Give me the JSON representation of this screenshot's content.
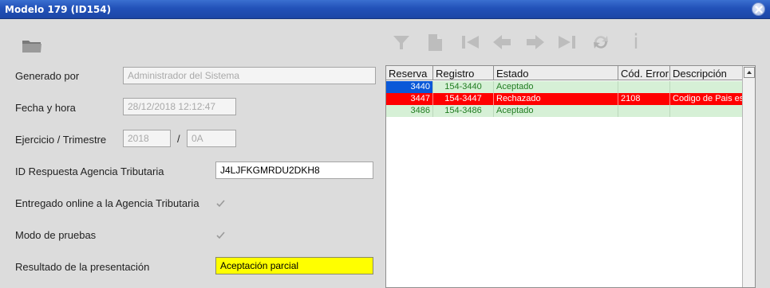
{
  "window": {
    "title": "Modelo 179 (ID154)"
  },
  "toolbar": {
    "icons": [
      "folder-icon",
      "filter-icon",
      "new-document-icon",
      "first-record-icon",
      "previous-record-icon",
      "next-record-icon",
      "last-record-icon",
      "refresh-icon",
      "info-icon"
    ],
    "info_glyph": "i"
  },
  "form": {
    "generado_por": {
      "label": "Generado por",
      "value": "Administrador del Sistema"
    },
    "fecha_hora": {
      "label": "Fecha y hora",
      "value": "28/12/2018  12:12:47"
    },
    "ejercicio": {
      "label": "Ejercicio / Trimestre",
      "year": "2018",
      "separator": "/",
      "quarter": "0A"
    },
    "id_respuesta": {
      "label": "ID Respuesta Agencia Tributaria",
      "value": "J4LJFKGMRDU2DKH8"
    },
    "entregado_online": {
      "label": "Entregado online a la Agencia Tributaria",
      "checked": true
    },
    "modo_pruebas": {
      "label": "Modo de pruebas",
      "checked": true
    },
    "resultado": {
      "label": "Resultado de la presentación",
      "value": "Aceptación parcial",
      "highlight": "#ffff00"
    }
  },
  "grid": {
    "columns": [
      "Reserva",
      "Registro",
      "Estado",
      "Cód. Error",
      "Descripción"
    ],
    "rows": [
      {
        "reserva": "3440",
        "registro": "154-3440",
        "estado": "Aceptado",
        "cod_error": "",
        "descripcion": "",
        "status": "ok"
      },
      {
        "reserva": "3447",
        "registro": "154-3447",
        "estado": "Rechazado",
        "cod_error": "2108",
        "descripcion": "Codigo de Pais es",
        "status": "error"
      },
      {
        "reserva": "3486",
        "registro": "154-3486",
        "estado": "Aceptado",
        "cod_error": "",
        "descripcion": "",
        "status": "ok"
      }
    ],
    "colors": {
      "ok_bg": "#d6f0d6",
      "ok_text": "#217c21",
      "error_bg": "#ff0000",
      "selected_bg": "#0a58d8"
    }
  }
}
